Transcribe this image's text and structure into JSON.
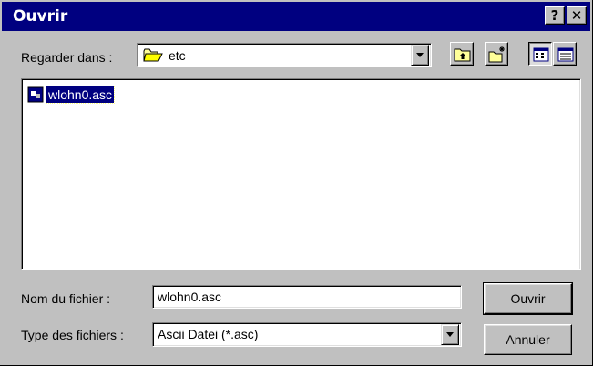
{
  "window": {
    "title": "Ouvrir",
    "help_button": "?",
    "close_button": "✕"
  },
  "lookin": {
    "label": "Regarder dans :",
    "value": "etc"
  },
  "file_list": {
    "items": [
      {
        "name": "wlohn0.asc",
        "selected": true
      }
    ]
  },
  "filename": {
    "label": "Nom du fichier :",
    "value": "wlohn0.asc"
  },
  "filetype": {
    "label": "Type des fichiers :",
    "value": "Ascii Datei (*.asc)"
  },
  "buttons": {
    "open": "Ouvrir",
    "cancel": "Annuler"
  },
  "icons": {
    "lookin_folder": "open-folder-icon",
    "up_one_level": "up-folder-icon",
    "new_folder": "new-folder-icon",
    "list_view": "list-view-icon",
    "details_view": "details-view-icon",
    "file": "data-file-icon"
  },
  "colors": {
    "titlebar": "#000080",
    "face": "#c0c0c0",
    "selection": "#000080"
  }
}
